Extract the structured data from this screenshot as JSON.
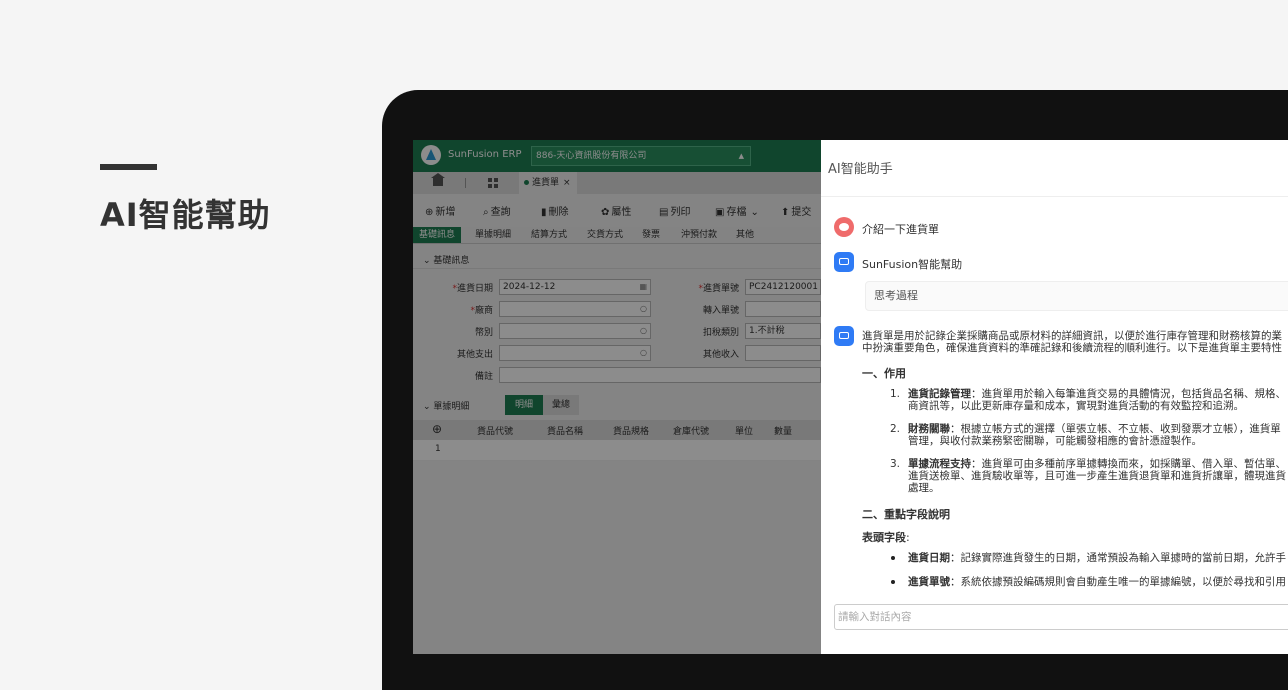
{
  "hero": {
    "title": "AI智能幫助"
  },
  "erp": {
    "brand": "SunFusion ERP",
    "company": "886-天心資訊股份有限公司",
    "doc_tab": "進貨單",
    "doc_tab_close": "×",
    "toolbar": {
      "new": "新增",
      "query": "查詢",
      "delete": "刪除",
      "properties": "屬性",
      "print": "列印",
      "save": "存檔",
      "submit": "提交"
    },
    "subtabs": [
      "基礎訊息",
      "單據明細",
      "結算方式",
      "交貨方式",
      "發票",
      "沖預付款",
      "其他"
    ],
    "basic_section": "基礎訊息",
    "fields": {
      "date_label": "進貨日期",
      "date_value": "2024-12-12",
      "vendor_label": "廠商",
      "currency_label": "幣別",
      "other_expense_label": "其他支出",
      "remark_label": "備註",
      "doc_no_label": "進貨單號",
      "doc_no_value": "PC2412120001",
      "transfer_no_label": "轉入單號",
      "tax_label": "扣稅類別",
      "tax_value": "1.不計稅",
      "other_income_label": "其他收入"
    },
    "detail_section": "單據明細",
    "detail_tabs": [
      "明細",
      "彙總"
    ],
    "table_headers": [
      "貨品代號",
      "貨品名稱",
      "貨品規格",
      "倉庫代號",
      "單位",
      "數量"
    ],
    "rows": [
      {
        "index": "1"
      }
    ]
  },
  "ai": {
    "title": "AI智能助手",
    "user_message": "介紹一下進貨單",
    "bot_name": "SunFusion智能幫助",
    "thinking": "思考過程",
    "intro_line1": "進貨單是用於記錄企業採購商品或原材料的詳細資訊，以便於進行庫存管理和財務核算的業",
    "intro_line2": "中扮演重要角色，確保進貨資料的準確記錄和後續流程的順利進行。以下是進貨單主要特性",
    "section1": "一、作用",
    "items": [
      {
        "n": "1.",
        "title": "進貨記錄管理",
        "line1": "：進貨單用於輸入每筆進貨交易的具體情況，包括貨品名稱、規格、",
        "line2": "商資訊等，以此更新庫存量和成本，實現對進貨活動的有效監控和追溯。",
        "line3": ""
      },
      {
        "n": "2.",
        "title": "財務關聯",
        "line1": "：根據立帳方式的選擇（單張立帳、不立帳、收到發票才立帳），進貨單",
        "line2": "管理，與收付款業務緊密關聯，可能觸發相應的會計憑證製作。",
        "line3": ""
      },
      {
        "n": "3.",
        "title": "單據流程支持",
        "line1": "：進貨單可由多種前序單據轉換而來，如採購單、借入單、暫估單、",
        "line2": "進貨送檢單、進貨驗收單等，且可進一步產生進貨退貨單和進貨折讓單，體現進貨",
        "line3": "處理。"
      }
    ],
    "section2": "二、重點字段說明",
    "header_fields_label": "表頭字段",
    "header_fields_colon": ":",
    "bullets": [
      {
        "title": "進貨日期",
        "text": "：記錄實際進貨發生的日期，通常預設為輸入單據時的當前日期，允許手"
      },
      {
        "title": "進貨單號",
        "text": "：系統依據預設編碼規則會自動產生唯一的單據編號，以便於尋找和引用"
      }
    ],
    "input_placeholder": "請輸入對話內容"
  }
}
